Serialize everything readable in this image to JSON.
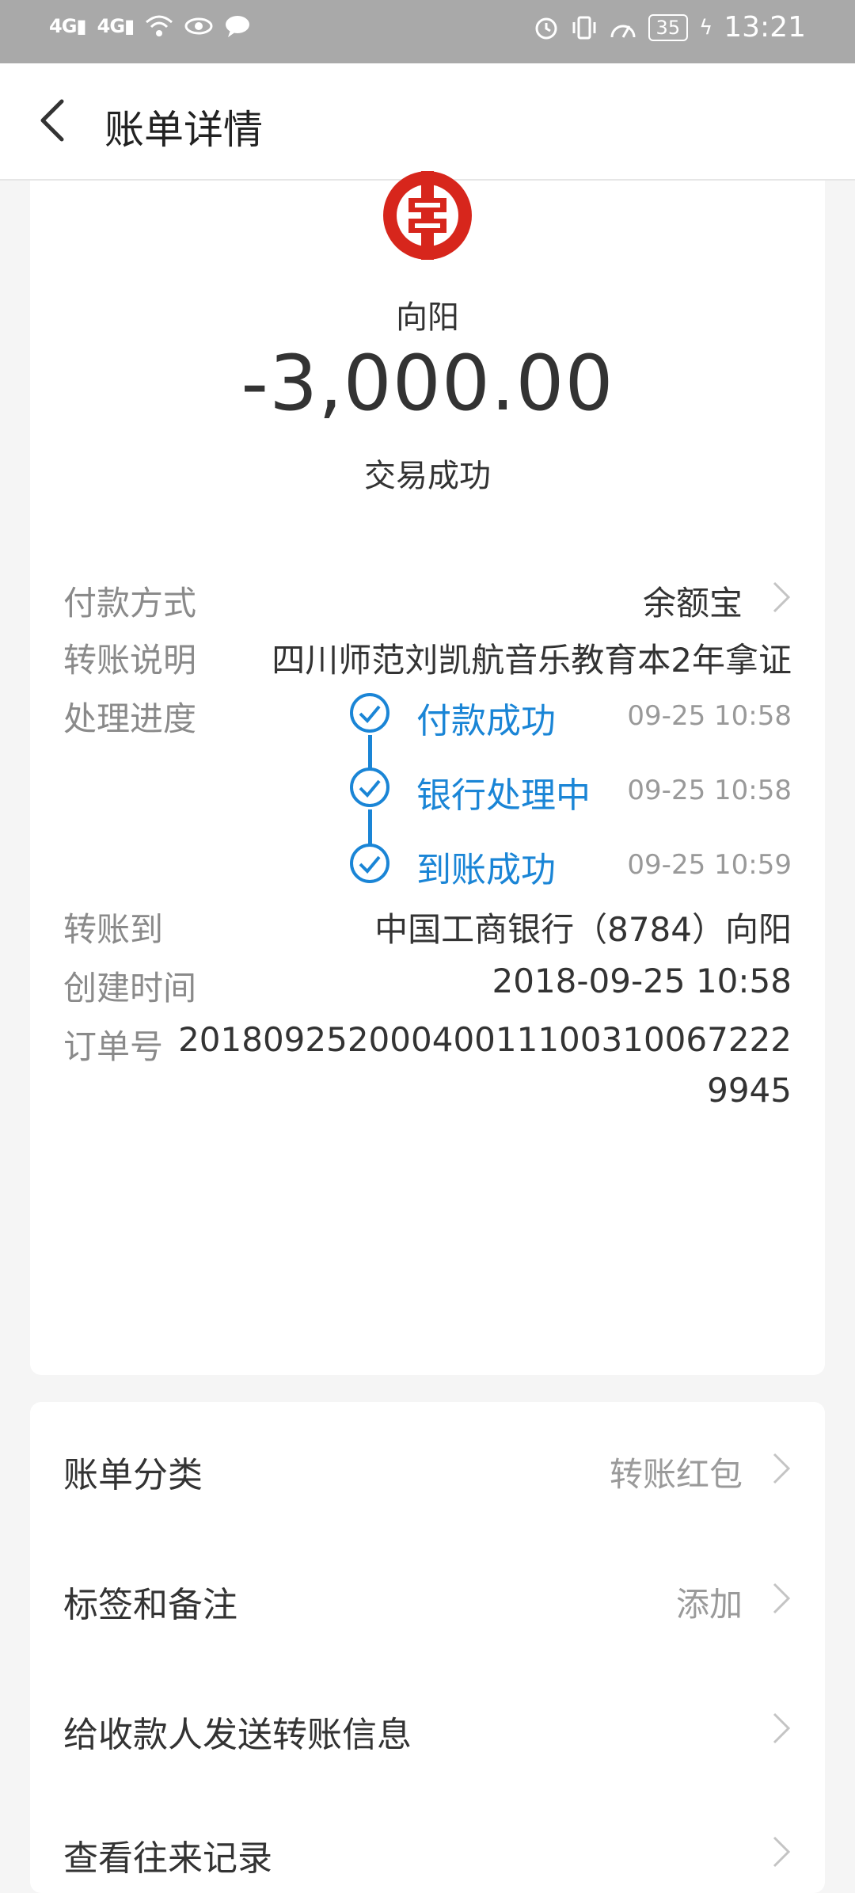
{
  "statusbar": {
    "signal1": "4G",
    "signal2": "4G",
    "battery": "35",
    "time": "13:21"
  },
  "nav": {
    "title": "账单详情"
  },
  "summary": {
    "payee": "向阳",
    "amount": "-3,000.00",
    "status": "交易成功",
    "logo_color": "#d7261c"
  },
  "details": {
    "payment_method": {
      "label": "付款方式",
      "value": "余额宝"
    },
    "transfer_note": {
      "label": "转账说明",
      "value": "四川师范刘凯航音乐教育本2年拿证"
    },
    "progress": {
      "label": "处理进度",
      "steps": [
        {
          "label": "付款成功",
          "time": "09-25 10:58"
        },
        {
          "label": "银行处理中",
          "time": "09-25 10:58"
        },
        {
          "label": "到账成功",
          "time": "09-25 10:59"
        }
      ]
    },
    "transfer_to": {
      "label": "转账到",
      "value": "中国工商银行（8784）向阳"
    },
    "created_time": {
      "label": "创建时间",
      "value": "2018-09-25 10:58"
    },
    "order_no": {
      "label": "订单号",
      "value_line1": "20180925200040011100310067222",
      "value_line2": "9945"
    }
  },
  "actions": {
    "category": {
      "label": "账单分类",
      "value": "转账红包"
    },
    "tags": {
      "label": "标签和备注",
      "value": "添加"
    },
    "send_info": {
      "label": "给收款人发送转账信息"
    },
    "history": {
      "label": "查看往来记录"
    }
  },
  "colors": {
    "accent": "#1a85d6",
    "statusbar": "#a9a9a9"
  }
}
